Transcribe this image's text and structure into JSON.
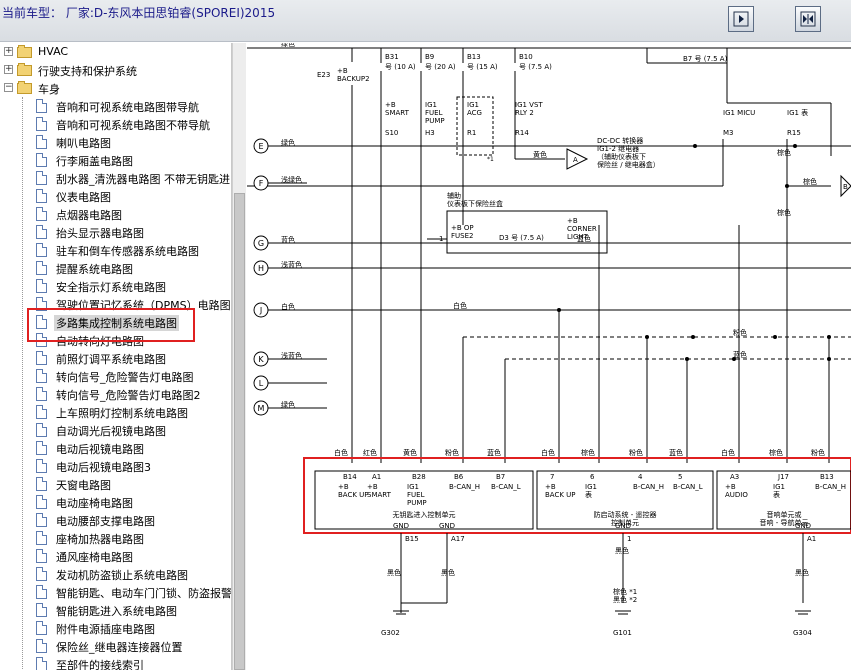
{
  "window": {
    "title": "当前车型： 厂家:D-东风本田思铂睿(SPOREI)2015",
    "buttons": [
      {
        "name": "expand-panel-button",
        "icon": "arrow-right-icon"
      },
      {
        "name": "collapse-panel-button",
        "icon": "arrows-inward-icon"
      }
    ]
  },
  "tree": {
    "selected_index": 15,
    "folders": [
      {
        "label": "HVAC",
        "expanded": false
      },
      {
        "label": "行驶支持和保护系统",
        "expanded": false
      },
      {
        "label": "车身",
        "expanded": true
      }
    ],
    "items": [
      "音响和可视系统电路图带导航",
      "音响和可视系统电路图不带导航",
      "喇叭电路图",
      "行李厢盖电路图",
      "刮水器_清洗器电路图 不带无钥匙进",
      "仪表电路图",
      "点烟器电路图",
      "抬头显示器电路图",
      "驻车和倒车传感器系统电路图",
      "提醒系统电路图",
      "安全指示灯系统电路图",
      "驾驶位置记忆系统（DPMS）电路图",
      "多路集成控制系统电路图",
      "自动转向灯电路图",
      "前照灯调平系统电路图",
      "转向信号_危险警告灯电路图",
      "转向信号_危险警告灯电路图2",
      "上车照明灯控制系统电路图",
      "自动调光后视镜电路图",
      "电动后视镜电路图",
      "电动后视镜电路图3",
      "天窗电路图",
      "电动座椅电路图",
      "电动腰部支撑电路图",
      "座椅加热器电路图",
      "通风座椅电路图",
      "发动机防盗锁止系统电路图",
      "智能钥匙、电动车门门锁、防盗报警",
      "智能钥匙进入系统电路图",
      "附件电源插座电路图",
      "保险丝_继电器连接器位置",
      "至部件的接线索引"
    ]
  },
  "diagram": {
    "top_labels": {
      "e23": "E23",
      "backup2": "+B\nBACKUP2",
      "fuses": [
        {
          "id": "B31",
          "rating": "号 (10 A)"
        },
        {
          "id": "B9",
          "rating": "号 (20 A)"
        },
        {
          "id": "B13",
          "rating": "号 (15 A)"
        },
        {
          "id": "B10",
          "rating": "号 (7.5 A)"
        },
        {
          "id": "B7",
          "rating": "号 (7.5 A)"
        }
      ],
      "relay_labels": [
        {
          "top": "+B",
          "name": "SMART",
          "pin": "S10"
        },
        {
          "top": "IG1",
          "name": "FUEL\nPUMP",
          "pin": "H3"
        },
        {
          "top": "IG1",
          "name": "ACG",
          "pin": "R1"
        },
        {
          "top": "IG1 VST",
          "name": "RLY 2",
          "pin": "R14"
        },
        {
          "top": "",
          "name": "IG1 MICU",
          "pin": "M3"
        },
        {
          "top": "",
          "name": "IG1 表",
          "pin": "R15"
        }
      ],
      "note_star1": "*1",
      "connector_a": "A",
      "connector_b": "B",
      "dcdc_text": "DC-DC 转换器\nIG1-2 继电器\n（辅助仪表板下\n保险丝 / 继电器盒）"
    },
    "aux_box": {
      "title": "辅助\n仪表板下保险丝盒",
      "left": "+B OP\nFUSE2",
      "pin": "1",
      "fuse": "D3 号 (7.5 A)",
      "right": "+B\nCORNER\nLIGHT"
    },
    "rows": [
      {
        "letter": "E",
        "color": "绿色"
      },
      {
        "letter": "F",
        "color": "浅绿色"
      },
      {
        "letter": "G",
        "color": "蓝色"
      },
      {
        "letter": "H",
        "color": "浅蓝色"
      },
      {
        "letter": "J",
        "color": "白色"
      },
      {
        "letter": "K",
        "color": "浅蓝色"
      },
      {
        "letter": "L",
        "color": ""
      },
      {
        "letter": "M",
        "color": "绿色"
      }
    ],
    "wire_colors": {
      "white": "白色",
      "red": "红色",
      "yellow": "黄色",
      "pink": "粉色",
      "blue": "蓝色",
      "brown": "棕色",
      "black": "黑色",
      "green": "绿色",
      "light_green": "浅绿色"
    },
    "modules": [
      {
        "title": "无钥匙进入控制单元",
        "pins": [
          {
            "pin": "B14",
            "label": "+B\nBACK UP"
          },
          {
            "pin": "A1",
            "label": "+B\nSMART"
          },
          {
            "pin": "B28",
            "label": "IG1\nFUEL\nPUMP"
          },
          {
            "pin": "B6",
            "label": "B-CAN_H"
          },
          {
            "pin": "B7",
            "label": "B-CAN_L"
          }
        ],
        "gnd": [
          {
            "pin": "B15",
            "label": "GND"
          },
          {
            "pin": "A17",
            "label": "GND"
          }
        ],
        "ground": "G302"
      },
      {
        "title": "防启动系统 - 遥控器\n控制单元",
        "pins": [
          {
            "pin": "7",
            "label": "+B\nBACK UP"
          },
          {
            "pin": "6",
            "label": "IG1\n表"
          },
          {
            "pin": "4",
            "label": "B-CAN_H"
          },
          {
            "pin": "5",
            "label": "B-CAN_L"
          }
        ],
        "gnd": [
          {
            "pin": "1",
            "label": "GND"
          }
        ],
        "ground": "G101",
        "ground_notes": "棕色 *1\n黑色 *2"
      },
      {
        "title": "音响单元或\n音响 - 导航单元",
        "pins": [
          {
            "pin": "A3",
            "label": "+B\nAUDIO"
          },
          {
            "pin": "J17",
            "label": "IG1\n表"
          },
          {
            "pin": "B13",
            "label": "B-CAN_H"
          }
        ],
        "gnd": [
          {
            "pin": "A1",
            "label": "GND"
          }
        ],
        "ground": "G304"
      }
    ]
  },
  "colors": {
    "accent_red": "#e02020",
    "title_text": "#1b1b8a",
    "selection": "#d6d6d6"
  }
}
